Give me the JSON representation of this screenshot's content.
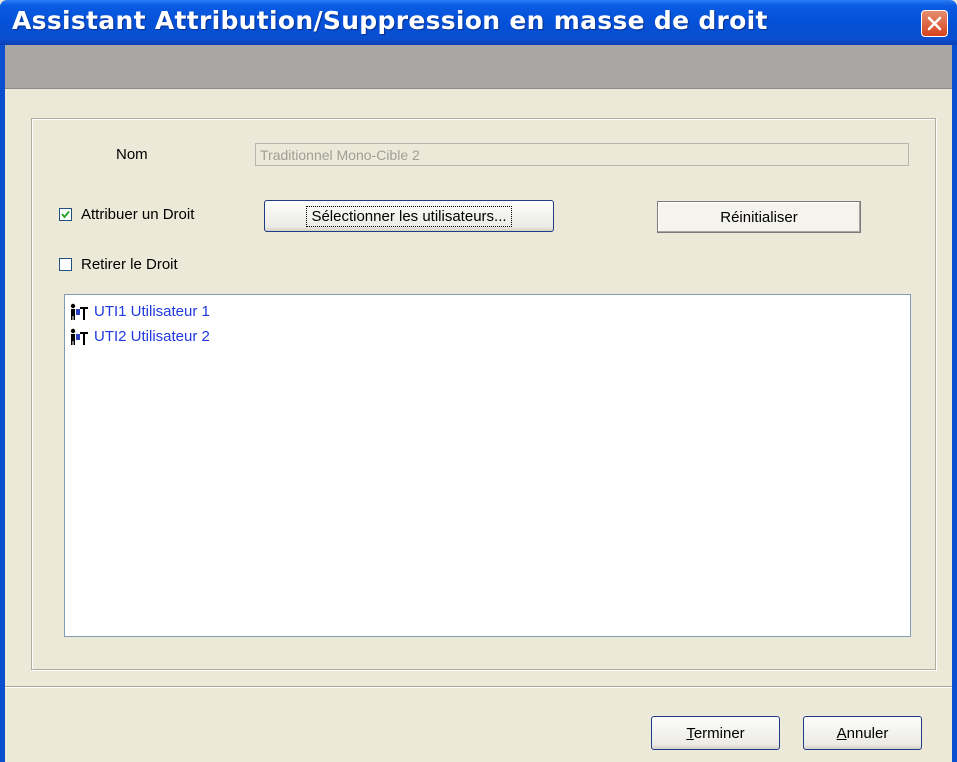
{
  "window": {
    "title": "Assistant Attribution/Suppression en masse de droit"
  },
  "form": {
    "name_label": "Nom",
    "name_value": "Traditionnel Mono-Cible 2",
    "assign": {
      "label": "Attribuer un Droit",
      "checked": true
    },
    "remove": {
      "label": "Retirer le Droit",
      "checked": false
    },
    "select_users_label": "Sélectionner les utilisateurs...",
    "reset_label": "Réinitialiser"
  },
  "users": [
    {
      "label": "UTI1 Utilisateur 1",
      "icon": "user-icon"
    },
    {
      "label": "UTI2 Utilisateur 2",
      "icon": "user-icon"
    }
  ],
  "footer": {
    "finish_first": "T",
    "finish_rest": "erminer",
    "cancel_first": "A",
    "cancel_rest": "nnuler"
  },
  "colors": {
    "titlebar": "#0451d8",
    "link_text": "#1f38e0",
    "dialog_bg": "#ece9d8"
  }
}
